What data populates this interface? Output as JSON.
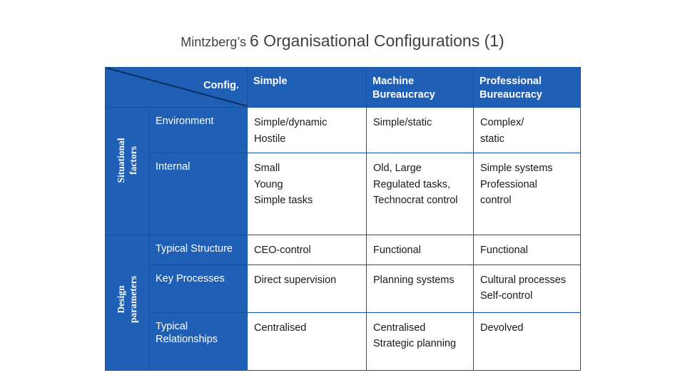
{
  "title": {
    "lead": "Mintzberg’s ",
    "main": "6 Organisational Configurations (1)"
  },
  "table": {
    "corner_label": "Config.",
    "column_headers": [
      "Simple",
      "Machine Bureaucracy",
      "Professional Bureaucracy"
    ],
    "side_labels": [
      "Situational factors",
      "Design parameters"
    ],
    "rows": [
      {
        "label": "Environment",
        "cells": [
          "Simple/dynamic\nHostile",
          "Simple/static",
          "Complex/\nstatic"
        ]
      },
      {
        "label": "Internal",
        "cells": [
          "Small\nYoung\nSimple tasks",
          "Old, Large\nRegulated tasks,\nTechnocrat control",
          "Simple systems\nProfessional\ncontrol"
        ]
      },
      {
        "label": "Typical Structure",
        "cells": [
          "CEO-control",
          "Functional",
          "Functional"
        ]
      },
      {
        "label": "Key Processes",
        "cells": [
          "Direct supervision",
          "Planning systems",
          "Cultural processes\nSelf-control"
        ]
      },
      {
        "label": "Typical Relationships",
        "cells": [
          "Centralised",
          "Centralised\nStrategic planning",
          "Devolved"
        ]
      }
    ]
  },
  "colors": {
    "table_blue": "#1f5fb5",
    "border_blue": "#12519e",
    "title_grey": "#404040"
  }
}
